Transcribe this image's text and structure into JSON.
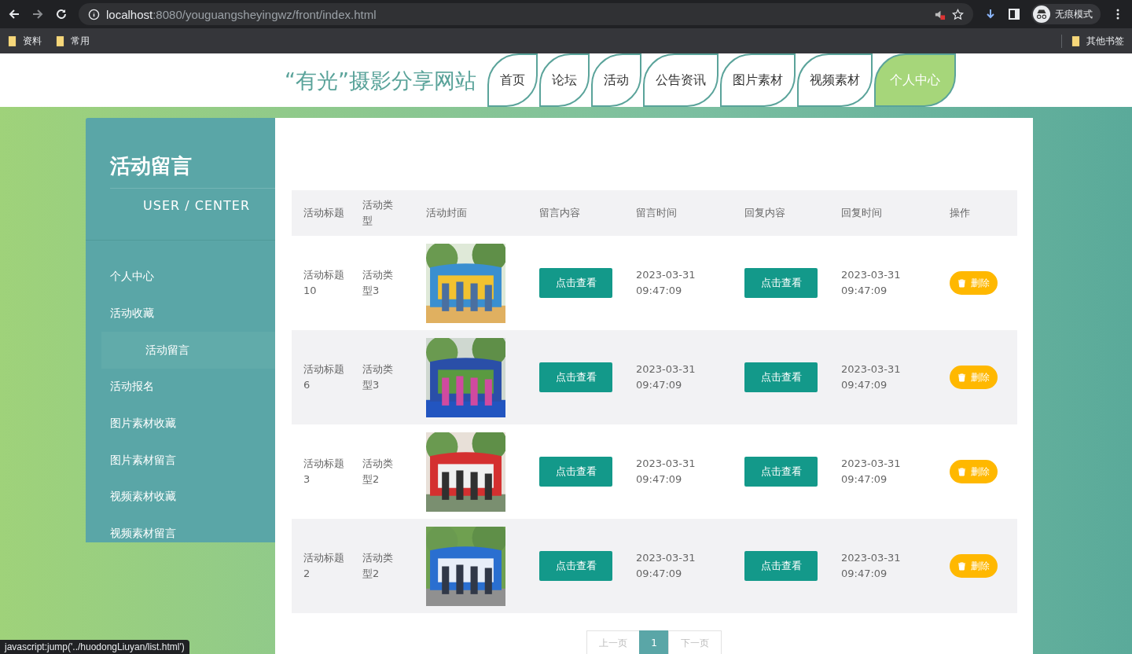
{
  "browser": {
    "url_host": "localhost",
    "url_path": ":8080/youguangsheyingwz/front/index.html",
    "profile": "无痕模式",
    "bookmarks": [
      "资料",
      "常用"
    ],
    "other_bookmarks": "其他书签"
  },
  "site": {
    "title": "“有光”摄影分享网站",
    "nav": [
      {
        "label": "首页",
        "selected": false
      },
      {
        "label": "论坛",
        "selected": false
      },
      {
        "label": "活动",
        "selected": false
      },
      {
        "label": "公告资讯",
        "selected": false
      },
      {
        "label": "图片素材",
        "selected": false
      },
      {
        "label": "视频素材",
        "selected": false
      },
      {
        "label": "个人中心",
        "selected": true
      }
    ]
  },
  "sidebar": {
    "title": "活动留言",
    "subtitle": "USER / CENTER",
    "items": [
      {
        "label": "个人中心",
        "selected": false
      },
      {
        "label": "活动收藏",
        "selected": false
      },
      {
        "label": "活动留言",
        "selected": true
      },
      {
        "label": "活动报名",
        "selected": false
      },
      {
        "label": "图片素材收藏",
        "selected": false
      },
      {
        "label": "图片素材留言",
        "selected": false
      },
      {
        "label": "视频素材收藏",
        "selected": false
      },
      {
        "label": "视频素材留言",
        "selected": false
      }
    ]
  },
  "table": {
    "columns": [
      "活动标题",
      "活动类型",
      "活动封面",
      "留言内容",
      "留言时间",
      "回复内容",
      "回复时间",
      "操作"
    ],
    "rows": [
      {
        "title": "活动标题10",
        "type": "活动类型3",
        "message_button": "点击查看",
        "message_time": "2023-03-31 09:47:09",
        "reply_button": "点击查看",
        "reply_time": "2023-03-31 09:47:09",
        "delete_button": "删除"
      },
      {
        "title": "活动标题6",
        "type": "活动类型3",
        "message_button": "点击查看",
        "message_time": "2023-03-31 09:47:09",
        "reply_button": "点击查看",
        "reply_time": "2023-03-31 09:47:09",
        "delete_button": "删除"
      },
      {
        "title": "活动标题3",
        "type": "活动类型2",
        "message_button": "点击查看",
        "message_time": "2023-03-31 09:47:09",
        "reply_button": "点击查看",
        "reply_time": "2023-03-31 09:47:09",
        "delete_button": "删除"
      },
      {
        "title": "活动标题2",
        "type": "活动类型2",
        "message_button": "点击查看",
        "message_time": "2023-03-31 09:47:09",
        "reply_button": "点击查看",
        "reply_time": "2023-03-31 09:47:09",
        "delete_button": "删除"
      }
    ]
  },
  "pagination": {
    "prev": "上一页",
    "pages": [
      {
        "label": "1",
        "selected": true
      }
    ],
    "next": "下一页"
  },
  "status_link": "javascript:jump('../huodongLiuyan/list.html')"
}
